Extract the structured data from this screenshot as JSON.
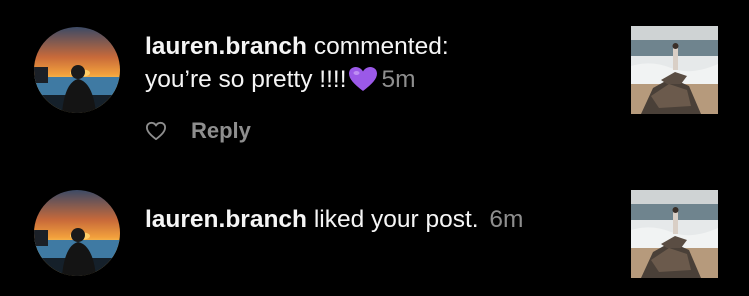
{
  "notifications": [
    {
      "username": "lauren.branch",
      "action": " commented:",
      "comment": "you’re so pretty !!!!",
      "emoji": "purple-heart",
      "time": "5m",
      "reply_label": "Reply",
      "avatar_icon": "profile-photo-sunset",
      "thumbnail_icon": "post-photo-beach-rocks"
    },
    {
      "username": "lauren.branch",
      "action": " liked your post.",
      "time": "6m",
      "avatar_icon": "profile-photo-sunset",
      "thumbnail_icon": "post-photo-beach-rocks"
    }
  ],
  "colors": {
    "background": "#000000",
    "text_primary": "#f5f5f5",
    "text_secondary": "#8e8e8e",
    "emoji_purple": "#9b59e8"
  }
}
